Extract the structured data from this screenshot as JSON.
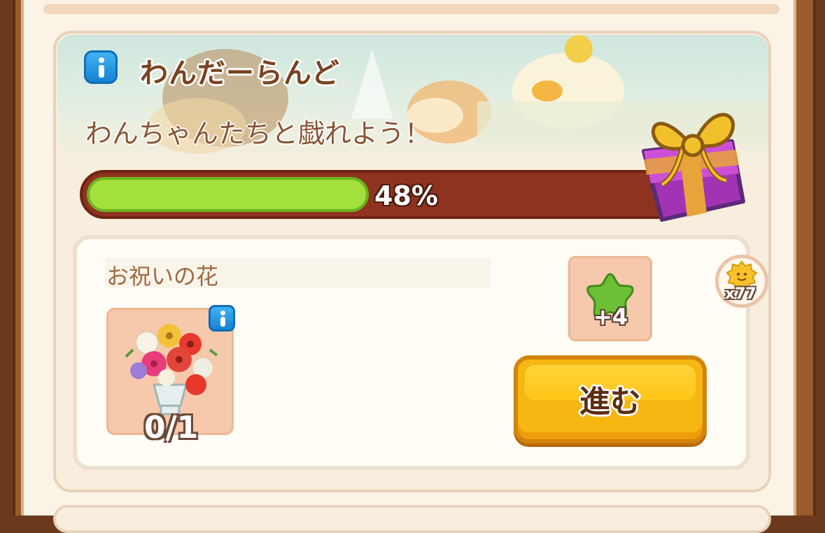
{
  "event": {
    "title": "わんだーらんど",
    "subtitle": "わんちゃんたちと戯れよう！",
    "progress_value": 0.48,
    "progress_label": "48%",
    "gift_icon": "gift-box-icon",
    "info_icon": "info-icon"
  },
  "quest": {
    "name": "お祝いの花",
    "item_icon": "flower-bouquet-icon",
    "item_count": "0/1",
    "reward_icon": "green-star-icon",
    "reward_amount": "+4",
    "go_button_label": "進む"
  },
  "coin_badge": {
    "icon": "sun-coin-icon",
    "count": "x77"
  },
  "colors": {
    "progress_fill": "#a3e03e",
    "progress_track": "#8f3320",
    "button": "#f6b713",
    "gift": "#cc4fd6"
  }
}
